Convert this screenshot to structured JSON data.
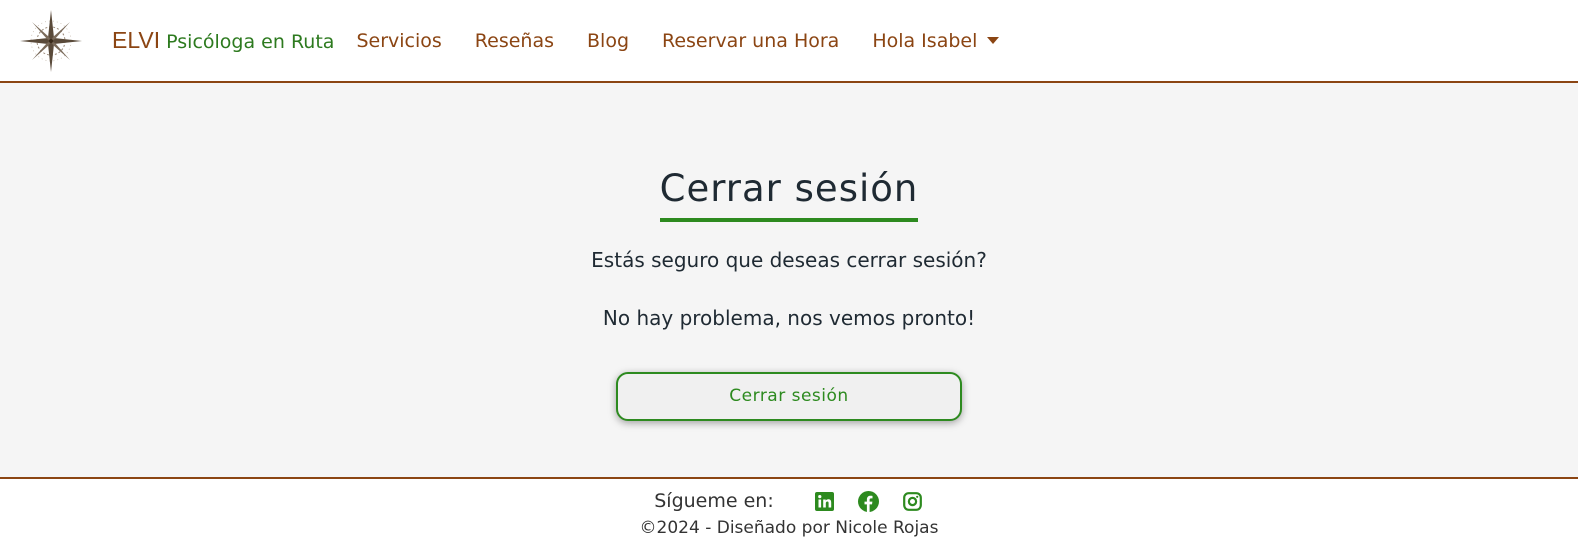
{
  "brand": {
    "name": "ELVI",
    "tagline": "Psicóloga en Ruta"
  },
  "nav": {
    "items": [
      "Servicios",
      "Reseñas",
      "Blog",
      "Reservar una Hora"
    ],
    "user_greeting": "Hola Isabel"
  },
  "main": {
    "title": "Cerrar sesión",
    "question": "Estás seguro que deseas cerrar sesión?",
    "message": "No hay problema, nos vemos pronto!",
    "button_label": "Cerrar sesión"
  },
  "footer": {
    "follow_label": "Sígueme en:",
    "social": [
      "linkedin-icon",
      "facebook-icon",
      "instagram-icon"
    ],
    "copyright": "©2024 - Diseñado por Nicole Rojas"
  },
  "colors": {
    "brown": "#8b4513",
    "green": "#2d8a1f",
    "background": "#f5f5f5"
  }
}
